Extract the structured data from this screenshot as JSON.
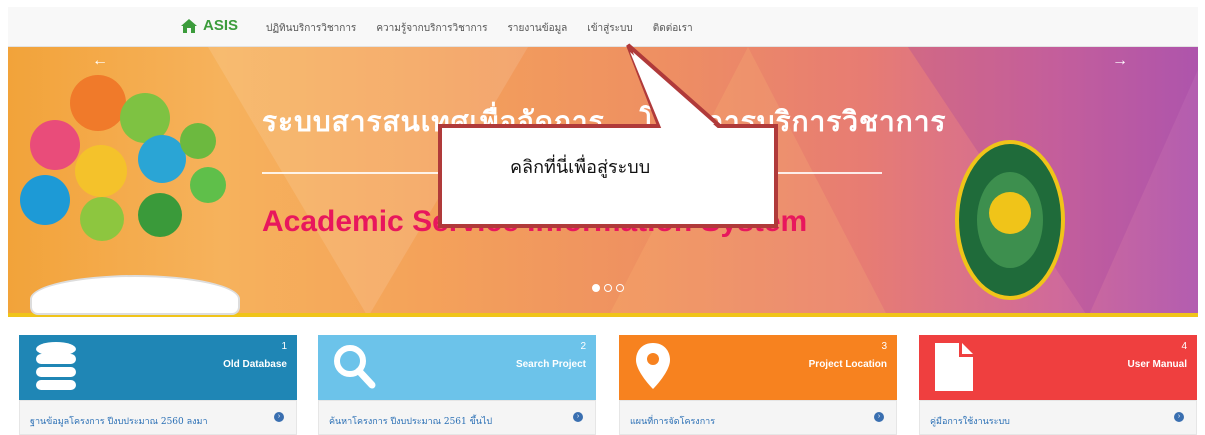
{
  "nav": {
    "brand": "ASIS",
    "items": [
      "ปฏิทินบริการวิชาการ",
      "ความรู้จากบริการวิชาการ",
      "รายงานข้อมูล",
      "เข้าสู่ระบบ",
      "ติดต่อเรา"
    ]
  },
  "banner": {
    "title_th": "ระบบสารสนเทศเพื่อจัดการ...โครงการบริการวิชาการ",
    "title_en": "Academic Service Information System",
    "prev_icon": "arrow-left-icon",
    "next_icon": "arrow-right-icon",
    "slides": 3,
    "active_slide": 1
  },
  "callout": {
    "text": "คลิกที่นี่เพื่อสู่ระบบ"
  },
  "cards": [
    {
      "number": "1",
      "title": "Old Database",
      "link": "ฐานข้อมูลโครงการ ปีงบประมาณ 2560 ลงมา",
      "color": "#1f86b5",
      "icon": "database-icon"
    },
    {
      "number": "2",
      "title": "Search Project",
      "link": "ค้นหาโครงการ ปีงบประมาณ 2561 ขึ้นไป",
      "color": "#6cc3ea",
      "icon": "search-icon"
    },
    {
      "number": "3",
      "title": "Project Location",
      "link": "แผนที่การจัดโครงการ",
      "color": "#f7821f",
      "icon": "map-marker-icon"
    },
    {
      "number": "4",
      "title": "User Manual",
      "link": "คู่มือการใช้งานระบบ",
      "color": "#ef3f3f",
      "icon": "file-icon"
    }
  ]
}
